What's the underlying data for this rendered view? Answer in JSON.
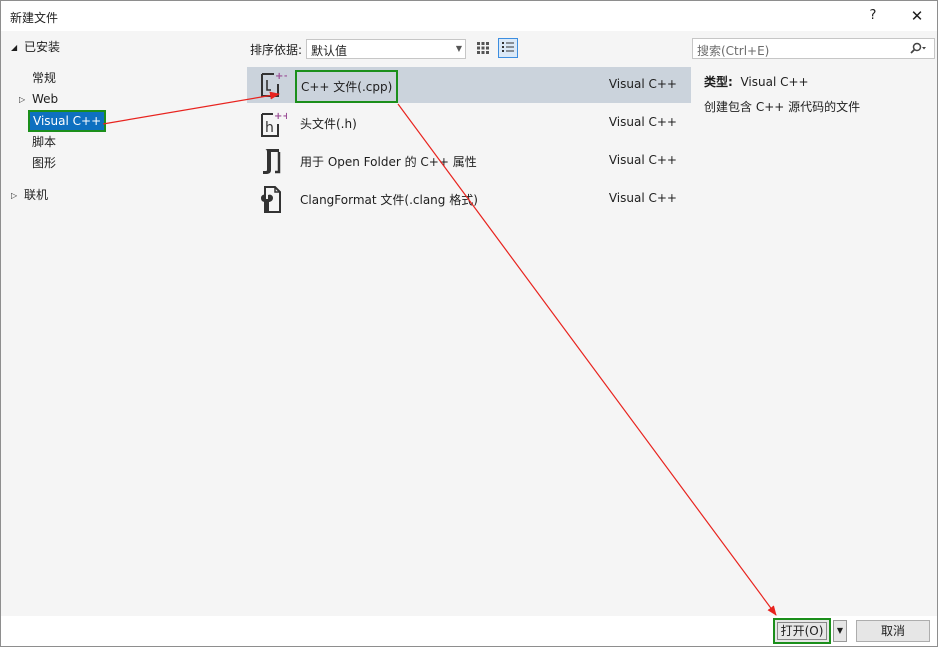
{
  "window": {
    "title": "新建文件",
    "help_label": "?",
    "close_label": "✕"
  },
  "tree": {
    "installed": "已安装",
    "items": [
      "常规",
      "Web",
      "Visual C++",
      "脚本",
      "图形"
    ],
    "online": "联机"
  },
  "toolbar": {
    "sort_label": "排序依据:",
    "sort_value": "默认值"
  },
  "search": {
    "placeholder": "搜索(Ctrl+E)"
  },
  "templates": [
    {
      "name": "C++ 文件(.cpp)",
      "type": "Visual C++",
      "icon": "cpp-file-icon"
    },
    {
      "name": "头文件(.h)",
      "type": "Visual C++",
      "icon": "header-file-icon"
    },
    {
      "name": "用于 Open Folder 的 C++ 属性",
      "type": "Visual C++",
      "icon": "cpp-properties-icon"
    },
    {
      "name": "ClangFormat 文件(.clang 格式)",
      "type": "Visual C++",
      "icon": "clangformat-file-icon"
    }
  ],
  "info": {
    "type_label": "类型:",
    "type_value": "Visual C++",
    "description": "创建包含 C++ 源代码的文件"
  },
  "buttons": {
    "open": "打开(O)",
    "cancel": "取消"
  },
  "colors": {
    "selection": "#0e70c0",
    "highlight_box": "#1b8f1b",
    "annotation_arrow": "#e8231e",
    "selected_row": "#cbd3dc"
  }
}
